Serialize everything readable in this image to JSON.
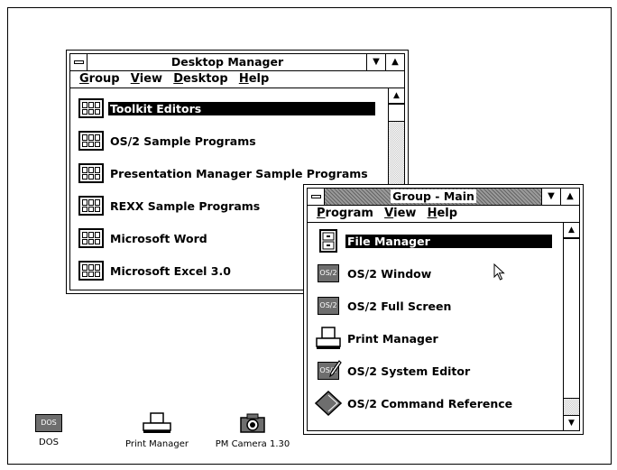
{
  "desktop_manager": {
    "title": "Desktop Manager",
    "menus": [
      {
        "key": "G",
        "rest": "roup"
      },
      {
        "key": "V",
        "rest": "iew"
      },
      {
        "key": "D",
        "rest": "esktop"
      },
      {
        "key": "H",
        "rest": "elp"
      }
    ],
    "items": [
      {
        "label": "Toolkit Editors",
        "selected": true,
        "icon": "program-group-icon"
      },
      {
        "label": "OS/2 Sample Programs",
        "selected": false,
        "icon": "program-group-icon"
      },
      {
        "label": "Presentation Manager Sample Programs",
        "selected": false,
        "icon": "program-group-icon"
      },
      {
        "label": "REXX Sample Programs",
        "selected": false,
        "icon": "program-group-icon"
      },
      {
        "label": "Microsoft Word",
        "selected": false,
        "icon": "program-group-icon"
      },
      {
        "label": "Microsoft Excel 3.0",
        "selected": false,
        "icon": "program-group-icon"
      }
    ]
  },
  "group_main": {
    "title": "Group - Main",
    "menus": [
      {
        "key": "P",
        "rest": "rogram"
      },
      {
        "key": "V",
        "rest": "iew"
      },
      {
        "key": "H",
        "rest": "elp"
      }
    ],
    "items": [
      {
        "label": "File Manager",
        "selected": true,
        "icon": "file-cabinet-icon"
      },
      {
        "label": "OS/2 Window",
        "selected": false,
        "icon": "os2-window-icon",
        "badge": "OS/2"
      },
      {
        "label": "OS/2 Full Screen",
        "selected": false,
        "icon": "os2-fullscreen-icon",
        "badge": "OS/2"
      },
      {
        "label": "Print Manager",
        "selected": false,
        "icon": "printer-icon"
      },
      {
        "label": "OS/2 System Editor",
        "selected": false,
        "icon": "editor-icon",
        "badge": "OS/2"
      },
      {
        "label": "OS/2 Command Reference",
        "selected": false,
        "icon": "book-icon"
      }
    ]
  },
  "desktop_icons": [
    {
      "label": "DOS",
      "badge": "DOS",
      "icon": "dos-icon"
    },
    {
      "label": "Print Manager",
      "icon": "printer-icon"
    },
    {
      "label": "PM Camera 1.30",
      "icon": "camera-icon"
    }
  ],
  "glyphs": {
    "min": "▼",
    "max": "▲",
    "up": "▲",
    "down": "▼"
  }
}
